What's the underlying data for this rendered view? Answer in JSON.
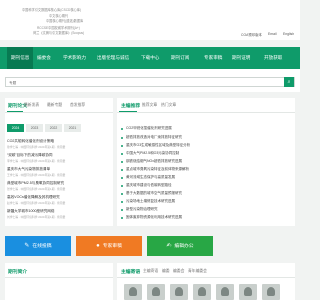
{
  "header": {
    "indexing": [
      "中国科学引文数据库核心库(CSCD核心库)",
      "中文核心期刊",
      "中国核心期刊(遴选)数据库",
      "RCCSE中国权威学术期刊(A+)",
      "荷兰《文摘与引文数据库》(Scopus)"
    ],
    "top_links": [
      "COA预印版本",
      "Email",
      "English"
    ]
  },
  "nav": [
    "期刊信息",
    "编委会",
    "学术影响力",
    "出版伦理与诚信",
    "下载中心",
    "期刊订阅",
    "专家审稿",
    "期刊证明",
    "开放获取"
  ],
  "search": {
    "placeholder": "专题",
    "button_icon": "search-icon"
  },
  "papers": {
    "title": "期刊论文",
    "tabs": [
      "最新发表",
      "最新专题",
      "首发推荐"
    ],
    "years": [
      "2024",
      "2023",
      "2022",
      "2021"
    ],
    "articles": [
      {
        "title": "CO2共轭转化催化剂设计策略",
        "meta": "徐学仁等 · 中国环境科学 2024年第1期 · 查阅量"
      },
      {
        "title": "“双碳”目标下的减污降碳协同",
        "meta": "李学仁等 · 中国环境科学 2024年第1期 · 查阅量"
      },
      {
        "title": "重庆市大气污染物排放清单",
        "meta": "王学仁等 · 中国环境科学 2024年第1期 · 查阅量"
      },
      {
        "title": "典型城市PM2.5与臭氧协同控制研究",
        "meta": "张学仁等 · 中国环境科学 2024年第1期 · 查阅量"
      },
      {
        "title": "高效VOCs催化降解及其机理研究",
        "meta": "赵学仁等 · 中国环境科学 2024年第1期 · 查阅量"
      },
      {
        "title": "新疆大学城市1000座研究网络",
        "meta": "刘学仁等 · 中国环境科学 2024年第1期 · 查阅量"
      }
    ]
  },
  "topics": {
    "title": "主编推荐",
    "tabs": [
      "推荐文章",
      "热门文章"
    ],
    "items": [
      "CO2甲烷化氢催化剂研究进展",
      "超低排放改造对电厂汞排放特征研究",
      "重庆市O3生成敏感性区域及典型特征分析",
      "中国大气PM2.5和O3污染协同控制",
      "钢铁烧结烟气NOx超低排放研究进展",
      "重点城市臭氧污染特征及前体物来源解析",
      "黄河流域生态保护与高质量发展",
      "重庆城市建设与低碳转型路径",
      "基于大数据的城市空气质量预报研究",
      "污染场地土壤修复技术研究进展",
      "新型污染物治理研究",
      "固体废弃物资源化利用技术研究进展"
    ]
  },
  "quick": [
    {
      "label": "在线投稿",
      "icon": "pen-icon",
      "color": "#1a8fe0"
    },
    {
      "label": "专家审稿",
      "icon": "user-icon",
      "color": "#f07a23"
    },
    {
      "label": "编辑办公",
      "icon": "edit-icon",
      "color": "#28a745"
    }
  ],
  "bottom": {
    "left_title": "期刊简介",
    "right_title": "主编寄语",
    "right_tabs": [
      "主编寄语",
      "编委",
      "编委会",
      "青年编委会"
    ]
  }
}
